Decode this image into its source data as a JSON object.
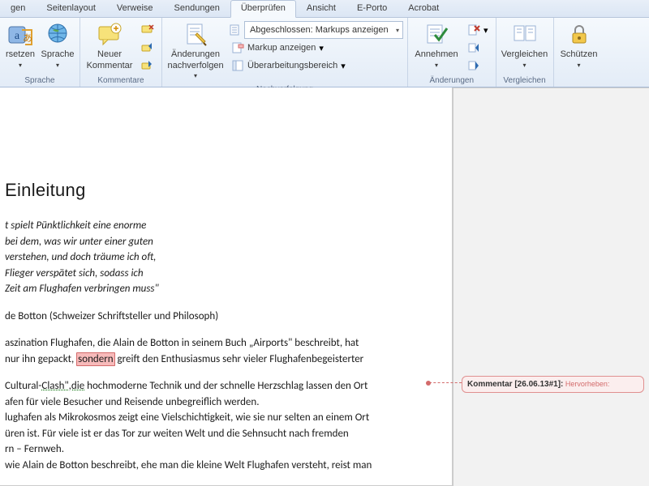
{
  "tabs": {
    "t0": "gen",
    "t1": "Seitenlayout",
    "t2": "Verweise",
    "t3": "Sendungen",
    "t4": "Überprüfen",
    "t5": "Ansicht",
    "t6": "E-Porto",
    "t7": "Acrobat"
  },
  "ribbon": {
    "sprache": {
      "group": "Sprache",
      "translate": "rsetzen",
      "language": "Sprache"
    },
    "kommentare": {
      "group": "Kommentare",
      "new_comment_l1": "Neuer",
      "new_comment_l2": "Kommentar"
    },
    "nachverfolgung": {
      "group": "Nachverfolgung",
      "track_l1": "Änderungen",
      "track_l2": "nachverfolgen",
      "combo": "Abgeschlossen: Markups anzeigen",
      "show_markup": "Markup anzeigen",
      "reviewing_pane": "Überarbeitungsbereich"
    },
    "aenderungen": {
      "group": "Änderungen",
      "accept": "Annehmen"
    },
    "vergleichen": {
      "group": "Vergleichen",
      "compare": "Vergleichen"
    },
    "schuetzen": {
      "protect": "Schützen"
    }
  },
  "document": {
    "heading": "Einleitung",
    "p1l1": "t spielt Pünktlichkeit eine enorme",
    "p1l2": "bei dem, was wir unter einer guten",
    "p1l3": "verstehen, und doch träume ich oft,",
    "p1l4": "Flieger verspätet sich, sodass ich",
    "p1l5": "Zeit am Flughafen verbringen muss\"",
    "p2": "de Botton (Schweizer Schriftsteller und Philosoph)",
    "p3a": "aszination Flughafen, die Alain de Botton in seinem Buch „Airports\" beschreibt, hat",
    "p3b_pre": " nur ihn gepackt, ",
    "p3b_hl": "sondern",
    "p3b_post": " greift den Enthusiasmus sehr vieler Flughafenbegeisterter",
    "p4a_pre": "Cultural-",
    "p4a_sq": "Clash\",die",
    "p4a_post": " hochmoderne Technik und der schnelle Herzschlag lassen den Ort",
    "p4b": "afen für viele Besucher und Reisende unbegreiflich werden.",
    "p5l1": "lughafen als Mikrokosmos zeigt eine Vielschichtigkeit, wie sie nur selten an einem Ort",
    "p5l2": "üren ist. Für viele ist er das Tor zur weiten Welt und die Sehnsucht nach fremden",
    "p5l3": "rn – Fernweh.",
    "p6": " wie Alain de Botton beschreibt, ehe man die kleine Welt Flughafen versteht, reist man"
  },
  "comment": {
    "label": "Kommentar [26.06.13#1]:",
    "body": " Hervorheben:"
  }
}
